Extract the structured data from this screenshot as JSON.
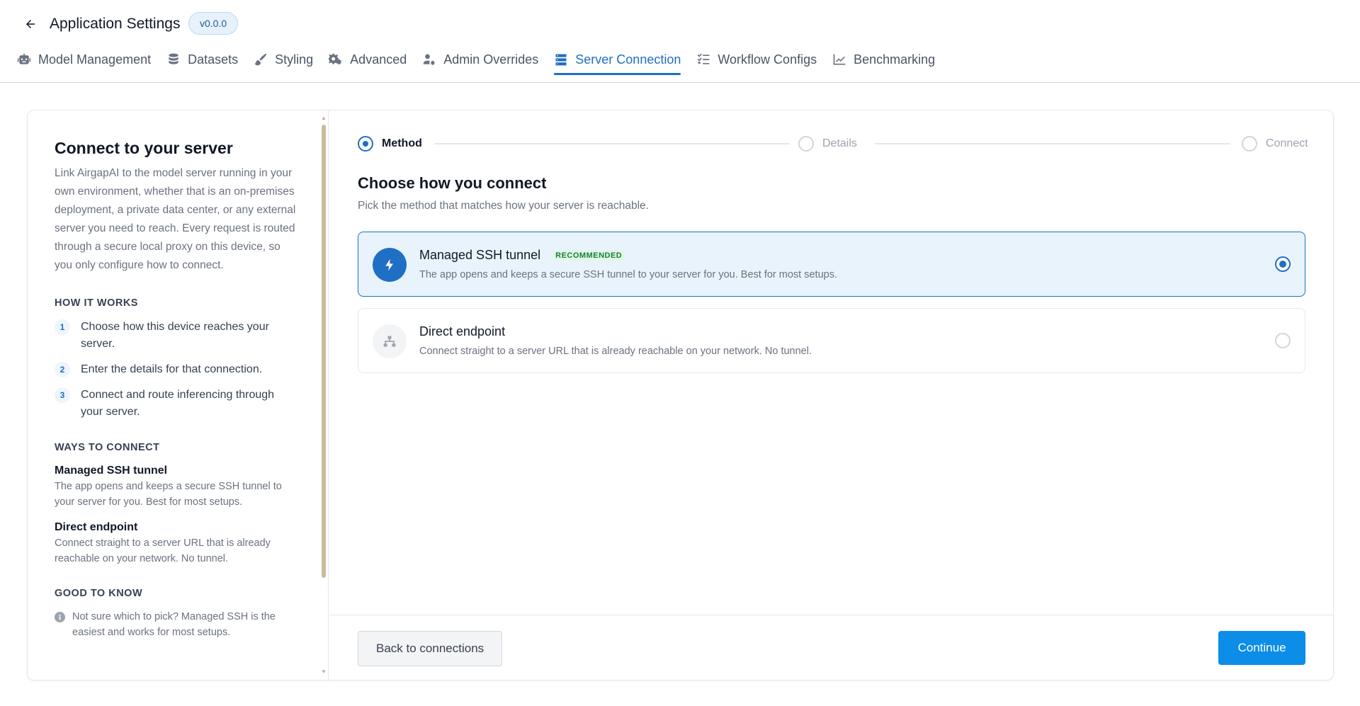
{
  "header": {
    "title": "Application Settings",
    "version": "v0.0.0"
  },
  "tabs": [
    {
      "label": "Model Management",
      "icon": "robot-icon"
    },
    {
      "label": "Datasets",
      "icon": "database-icon"
    },
    {
      "label": "Styling",
      "icon": "paintbrush-icon"
    },
    {
      "label": "Advanced",
      "icon": "gears-icon"
    },
    {
      "label": "Admin Overrides",
      "icon": "user-gear-icon"
    },
    {
      "label": "Server Connection",
      "icon": "server-icon",
      "active": true
    },
    {
      "label": "Workflow Configs",
      "icon": "list-check-icon"
    },
    {
      "label": "Benchmarking",
      "icon": "chart-line-icon"
    }
  ],
  "sidebar": {
    "title": "Connect to your server",
    "description": "Link AirgapAI to the model server running in your own environment, whether that is an on-premises deployment, a private data center, or any external server you need to reach. Every request is routed through a secure local proxy on this device, so you only configure how to connect.",
    "how_it_works": {
      "heading": "HOW IT WORKS",
      "steps": [
        {
          "num": "1",
          "text": "Choose how this device reaches your server."
        },
        {
          "num": "2",
          "text": "Enter the details for that connection."
        },
        {
          "num": "3",
          "text": "Connect and route inferencing through your server."
        }
      ]
    },
    "ways": {
      "heading": "WAYS TO CONNECT",
      "items": [
        {
          "title": "Managed SSH tunnel",
          "desc": "The app opens and keeps a secure SSH tunnel to your server for you. Best for most setups."
        },
        {
          "title": "Direct endpoint",
          "desc": "Connect straight to a server URL that is already reachable on your network. No tunnel."
        }
      ]
    },
    "good_to_know": {
      "heading": "GOOD TO KNOW",
      "text": "Not sure which to pick? Managed SSH is the easiest and works for most setups."
    }
  },
  "stepper": [
    {
      "label": "Method",
      "active": true
    },
    {
      "label": "Details",
      "active": false
    },
    {
      "label": "Connect",
      "active": false
    }
  ],
  "main": {
    "title": "Choose how you connect",
    "subtitle": "Pick the method that matches how your server is reachable.",
    "options": [
      {
        "title": "Managed SSH tunnel",
        "badge": "RECOMMENDED",
        "desc": "The app opens and keeps a secure SSH tunnel to your server for you. Best for most setups.",
        "icon": "bolt-icon",
        "selected": true
      },
      {
        "title": "Direct endpoint",
        "badge": "",
        "desc": "Connect straight to a server URL that is already reachable on your network. No tunnel.",
        "icon": "network-icon",
        "selected": false
      }
    ]
  },
  "footer": {
    "back_label": "Back to connections",
    "continue_label": "Continue"
  },
  "colors": {
    "accent": "#1f6fc4",
    "primary_button": "#0b8de8",
    "badge_green": "#15803d"
  }
}
